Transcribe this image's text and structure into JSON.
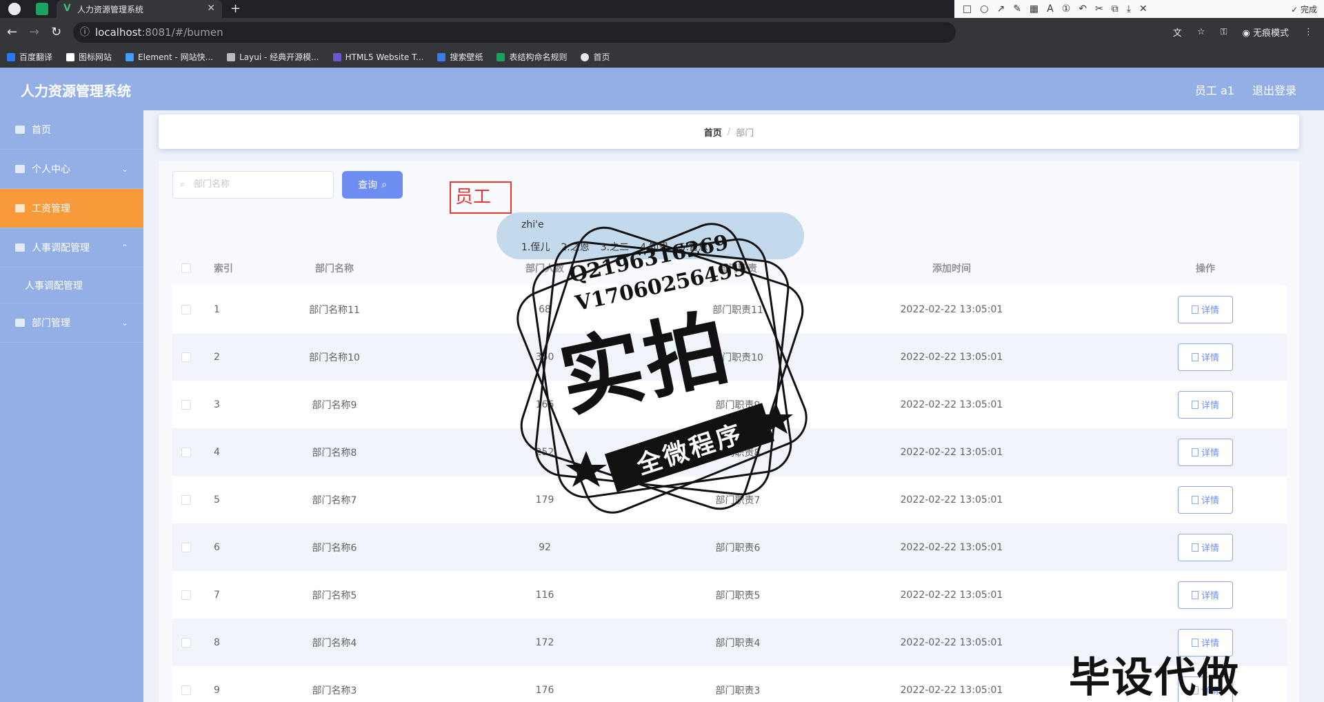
{
  "browser": {
    "tab_title": "人力资源管理系统",
    "url_host": "localhost",
    "url_rest": ":8081/#/bumen",
    "profile_label": "无痕模式",
    "bookmarks": [
      "百度翻译",
      "图标网站",
      "Element - 网站快...",
      "Layui - 经典开源模...",
      "HTML5 Website T...",
      "搜索壁纸",
      "表结构命名规则",
      "首页"
    ]
  },
  "screenshot_tool": {
    "done_label": "完成",
    "font_size": "20",
    "active_color": "#f23a3a",
    "palette": [
      "#000000",
      "#6b6b6b",
      "#8b0000",
      "#c0392b",
      "#d35400",
      "#27ae60",
      "#2980b9",
      "#8e44ad",
      "#ffffff",
      "#b0b0b0",
      "#e74c3c",
      "#f1c40f",
      "#a3cb38",
      "#3498db",
      "#e84393",
      "#1abc9c"
    ]
  },
  "app": {
    "title": "人力资源管理系统",
    "user": "员工 a1",
    "logout": "退出登录",
    "accent": "#93afe5",
    "active_menu_color": "#f89a3a"
  },
  "sidebar": {
    "items": [
      {
        "label": "首页"
      },
      {
        "label": "个人中心"
      },
      {
        "label": "工资管理"
      },
      {
        "label": "人事调配管理"
      },
      {
        "label": "人事调配管理"
      },
      {
        "label": "部门管理"
      }
    ]
  },
  "breadcrumb": {
    "home": "首页",
    "current": "部门"
  },
  "search": {
    "placeholder": "部门名称",
    "button": "查询"
  },
  "table": {
    "headers": [
      "索引",
      "部门名称",
      "部门人数",
      "部门职责",
      "添加时间",
      "操作"
    ],
    "detail_label": "详情",
    "rows": [
      {
        "idx": "1",
        "name": "部门名称11",
        "count": "68",
        "duty": "部门职责11",
        "time": "2022-02-22 13:05:01"
      },
      {
        "idx": "2",
        "name": "部门名称10",
        "count": "360",
        "duty": "部门职责10",
        "time": "2022-02-22 13:05:01"
      },
      {
        "idx": "3",
        "name": "部门名称9",
        "count": "166",
        "duty": "部门职责9",
        "time": "2022-02-22 13:05:01"
      },
      {
        "idx": "4",
        "name": "部门名称8",
        "count": "252",
        "duty": "部门职责8",
        "time": "2022-02-22 13:05:01"
      },
      {
        "idx": "5",
        "name": "部门名称7",
        "count": "179",
        "duty": "部门职责7",
        "time": "2022-02-22 13:05:01"
      },
      {
        "idx": "6",
        "name": "部门名称6",
        "count": "92",
        "duty": "部门职责6",
        "time": "2022-02-22 13:05:01"
      },
      {
        "idx": "7",
        "name": "部门名称5",
        "count": "116",
        "duty": "部门职责5",
        "time": "2022-02-22 13:05:01"
      },
      {
        "idx": "8",
        "name": "部门名称4",
        "count": "172",
        "duty": "部门职责4",
        "time": "2022-02-22 13:05:01"
      },
      {
        "idx": "9",
        "name": "部门名称3",
        "count": "176",
        "duty": "部门职责3",
        "time": "2022-02-22 13:05:01"
      }
    ]
  },
  "annotation": {
    "text": "员工"
  },
  "ime": {
    "pinyin": "zhi'e",
    "candidates": [
      "1.侄儿",
      "2.之恩",
      "3.之二",
      "4.知恩",
      "5.智恩"
    ]
  },
  "watermark": {
    "qq": "Q2196316269",
    "wechat": "V17060256499",
    "big": "实拍",
    "ribbon": "全微程序",
    "corner": "毕设代做"
  }
}
